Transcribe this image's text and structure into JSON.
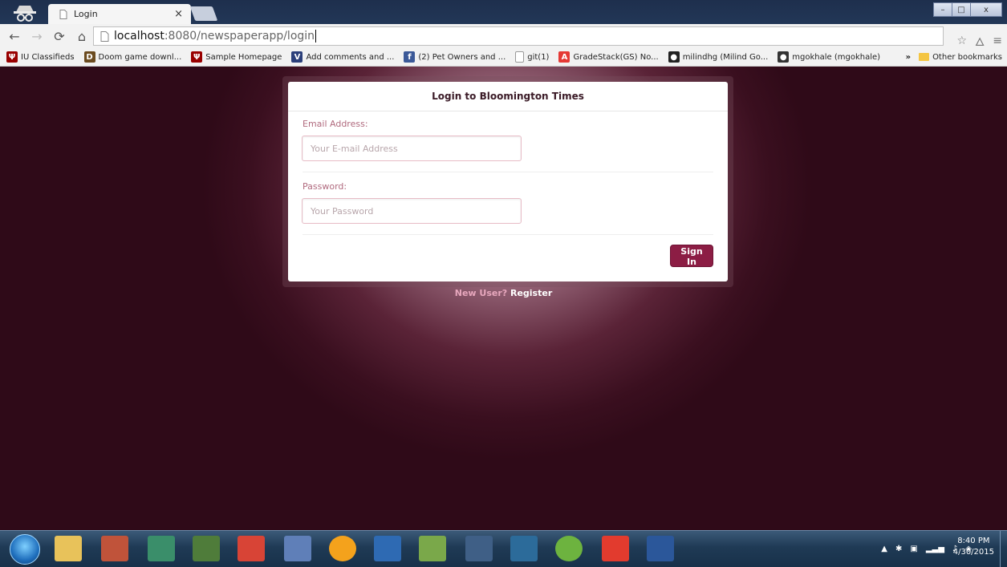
{
  "browser": {
    "tab_title": "Login",
    "tab_close": "×",
    "url_host": "localhost",
    "url_path": ":8080/newspaperapp/login",
    "win_min": "–",
    "win_max": "□",
    "win_close": "x"
  },
  "bookmarks": [
    {
      "label": "IU Classifieds",
      "icon": "iu-icon",
      "color": "#990000",
      "glyph": "Ψ"
    },
    {
      "label": "Doom game downl...",
      "icon": "doom-icon",
      "color": "#6b4b1f",
      "glyph": "D"
    },
    {
      "label": "Sample Homepage",
      "icon": "iu-icon",
      "color": "#990000",
      "glyph": "Ψ"
    },
    {
      "label": "Add comments and ...",
      "icon": "vs-icon",
      "color": "#2b3f7a",
      "glyph": "V"
    },
    {
      "label": "(2) Pet Owners and ...",
      "icon": "facebook-icon",
      "color": "#3b5998",
      "glyph": "f"
    },
    {
      "label": "git(1)",
      "icon": "page-icon",
      "color": "#ffffff",
      "glyph": ""
    },
    {
      "label": "GradeStack(GS) No...",
      "icon": "gradestack-icon",
      "color": "#e53935",
      "glyph": "A"
    },
    {
      "label": "milindhg (Milind Go...",
      "icon": "github-icon",
      "color": "#222222",
      "glyph": "●"
    },
    {
      "label": "mgokhale (mgokhale)",
      "icon": "github-icon",
      "color": "#333333",
      "glyph": "●"
    }
  ],
  "bookmarks_more": "»",
  "other_bookmarks": "Other bookmarks",
  "login": {
    "heading": "Login to Bloomington Times",
    "email_label": "Email Address:",
    "email_placeholder": "Your E-mail Address",
    "email_value": "",
    "password_label": "Password:",
    "password_placeholder": "Your Password",
    "password_value": "",
    "signin_label": "Sign In",
    "new_user_text": "New User?",
    "register_link": "Register"
  },
  "taskbar": {
    "time": "8:40 PM",
    "date": "4/30/2015"
  },
  "colors": {
    "accent": "#8c1d44",
    "page_bg": "#2f0a18"
  }
}
